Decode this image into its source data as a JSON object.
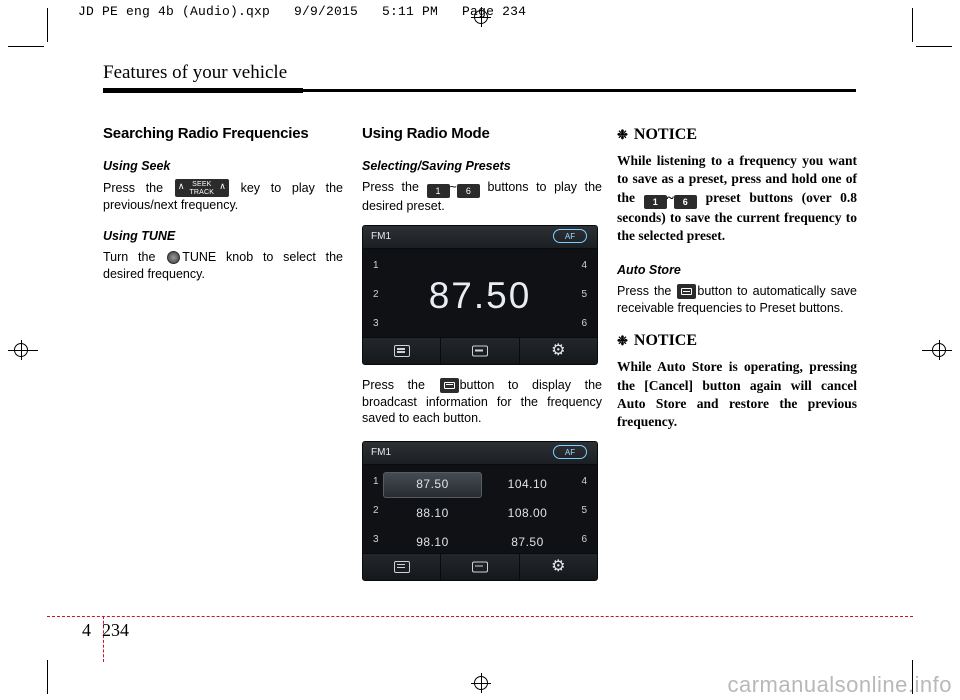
{
  "slug": "JD PE eng 4b (Audio).qxp   9/9/2015   5:11 PM   Page 234",
  "running_head": "Features of your vehicle",
  "folio": {
    "chapter": "4",
    "page": "234"
  },
  "watermark": "carmanualsonline.info",
  "col1": {
    "section_title": "Searching Radio Frequencies",
    "sub1": "Using Seek",
    "p1_a": "Press the",
    "p1_b": "key to play the previous/next frequency.",
    "seek_key": {
      "top": "SEEK",
      "bottom": "TRACK",
      "left_arrow": "∧",
      "right_arrow": "∧"
    },
    "sub2": "Using TUNE",
    "p2_a": "Turn the",
    "p2_b": "TUNE knob to select the desired frequency."
  },
  "col2": {
    "section_title": "Using Radio Mode",
    "sub1": "Selecting/Saving Presets",
    "p1_a": "Press the",
    "p1_sep": "~",
    "p1_b": "buttons to play the desired preset.",
    "key_1": "1",
    "key_6": "6",
    "p2_a": "Press the",
    "p2_b": "button to display the broadcast information for the frequency saved to each button.",
    "screen1": {
      "band": "FM1",
      "af": "AF",
      "frequency": "87.50",
      "preset_left": [
        "1",
        "2",
        "3"
      ],
      "preset_right": [
        "4",
        "5",
        "6"
      ],
      "bottom_icons": [
        "list-icon",
        "info-card-icon",
        "gear-icon"
      ]
    },
    "screen2": {
      "band": "FM1",
      "af": "AF",
      "preset_left": [
        "1",
        "2",
        "3"
      ],
      "preset_right": [
        "4",
        "5",
        "6"
      ],
      "values_left": [
        "87.50",
        "88.10",
        "98.10"
      ],
      "values_right": [
        "104.10",
        "108.00",
        "87.50"
      ],
      "bottom_icons": [
        "list-icon",
        "info-card-icon",
        "gear-icon"
      ]
    }
  },
  "col3": {
    "notice1_label": "NOTICE",
    "notice1_star": "❉",
    "notice1_a": "While listening to a frequency you want to save as a preset, press and hold one of the",
    "notice1_sep": "~",
    "notice1_b": "preset buttons (over 0.8 seconds) to save the current frequency to the selected preset.",
    "key_1": "1",
    "key_6": "6",
    "sub_auto_store": "Auto Store",
    "p_auto_a": "Press the",
    "p_auto_b": "button to automatically save receivable frequencies to Preset buttons.",
    "notice2_label": "NOTICE",
    "notice2_star": "❉",
    "notice2_text": "While Auto Store is operating, pressing the [Cancel] button again will cancel Auto Store and restore the previous frequency."
  }
}
